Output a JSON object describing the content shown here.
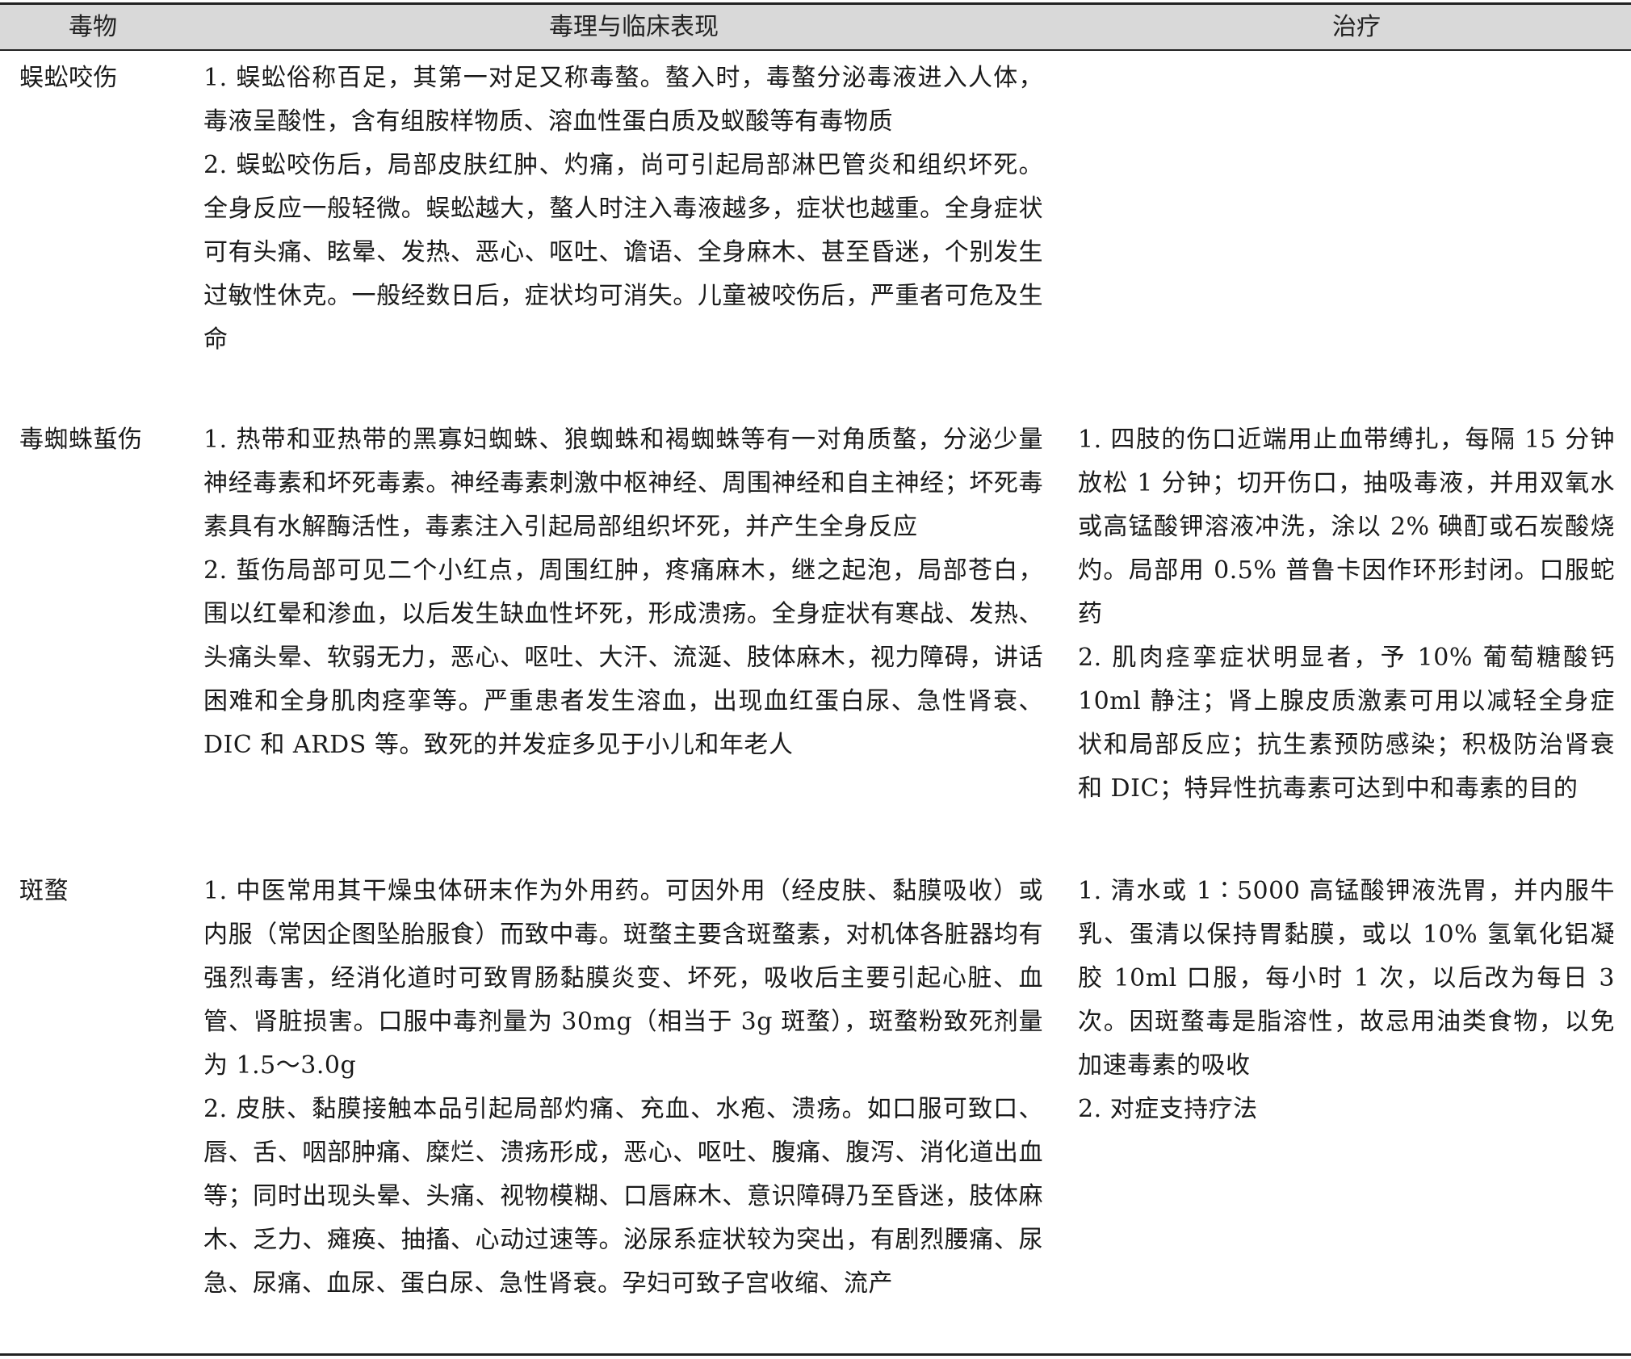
{
  "table": {
    "headers": {
      "poison": "毒物",
      "clinical": "毒理与临床表现",
      "treatment": "治疗"
    },
    "rows": [
      {
        "name": "蜈蚣咬伤",
        "clinical": [
          "1. 蜈蚣俗称百足，其第一对足又称毒螯。螯入时，毒螯分泌毒液进入人体，毒液呈酸性，含有组胺样物质、溶血性蛋白质及蚁酸等有毒物质",
          "2. 蜈蚣咬伤后，局部皮肤红肿、灼痛，尚可引起局部淋巴管炎和组织坏死。全身反应一般轻微。蜈蚣越大，螯人时注入毒液越多，症状也越重。全身症状可有头痛、眩晕、发热、恶心、呕吐、谵语、全身麻木、甚至昏迷，个别发生过敏性休克。一般经数日后，症状均可消失。儿童被咬伤后，严重者可危及生命"
        ],
        "treatment": []
      },
      {
        "name": "毒蜘蛛蜇伤",
        "clinical": [
          "1. 热带和亚热带的黑寡妇蜘蛛、狼蜘蛛和褐蜘蛛等有一对角质螯，分泌少量神经毒素和坏死毒素。神经毒素刺激中枢神经、周围神经和自主神经；坏死毒素具有水解酶活性，毒素注入引起局部组织坏死，并产生全身反应",
          "2. 蜇伤局部可见二个小红点，周围红肿，疼痛麻木，继之起泡，局部苍白，围以红晕和渗血，以后发生缺血性坏死，形成溃疡。全身症状有寒战、发热、头痛头晕、软弱无力，恶心、呕吐、大汗、流涎、肢体麻木，视力障碍，讲话困难和全身肌肉痉挛等。严重患者发生溶血，出现血红蛋白尿、急性肾衰、DIC 和 ARDS 等。致死的并发症多见于小儿和年老人"
        ],
        "treatment": [
          "1. 四肢的伤口近端用止血带缚扎，每隔 15 分钟放松 1 分钟；切开伤口，抽吸毒液，并用双氧水或高锰酸钾溶液冲洗，涂以 2% 碘酊或石炭酸烧灼。局部用 0.5% 普鲁卡因作环形封闭。口服蛇药",
          "2. 肌肉痉挛症状明显者，予 10% 葡萄糖酸钙 10ml 静注；肾上腺皮质激素可用以减轻全身症状和局部反应；抗生素预防感染；积极防治肾衰和 DIC；特异性抗毒素可达到中和毒素的目的"
        ]
      },
      {
        "name": "斑蝥",
        "clinical": [
          "1. 中医常用其干燥虫体研末作为外用药。可因外用（经皮肤、黏膜吸收）或内服（常因企图坠胎服食）而致中毒。斑蝥主要含斑蝥素，对机体各脏器均有强烈毒害，经消化道时可致胃肠黏膜炎变、坏死，吸收后主要引起心脏、血管、肾脏损害。口服中毒剂量为 30mg（相当于 3g 斑蝥），斑蝥粉致死剂量为 1.5～3.0g",
          "2. 皮肤、黏膜接触本品引起局部灼痛、充血、水疱、溃疡。如口服可致口、唇、舌、咽部肿痛、糜烂、溃疡形成，恶心、呕吐、腹痛、腹泻、消化道出血等；同时出现头晕、头痛、视物模糊、口唇麻木、意识障碍乃至昏迷，肢体麻木、乏力、瘫痪、抽搐、心动过速等。泌尿系症状较为突出，有剧烈腰痛、尿急、尿痛、血尿、蛋白尿、急性肾衰。孕妇可致子宫收缩、流产"
        ],
        "treatment": [
          "1. 清水或 1∶5000 高锰酸钾液洗胃，并内服牛乳、蛋清以保持胃黏膜，或以 10% 氢氧化铝凝胶 10ml 口服，每小时 1 次，以后改为每日 3 次。因斑蝥毒是脂溶性，故忌用油类食物，以免加速毒素的吸收",
          "2. 对症支持疗法"
        ]
      }
    ]
  }
}
